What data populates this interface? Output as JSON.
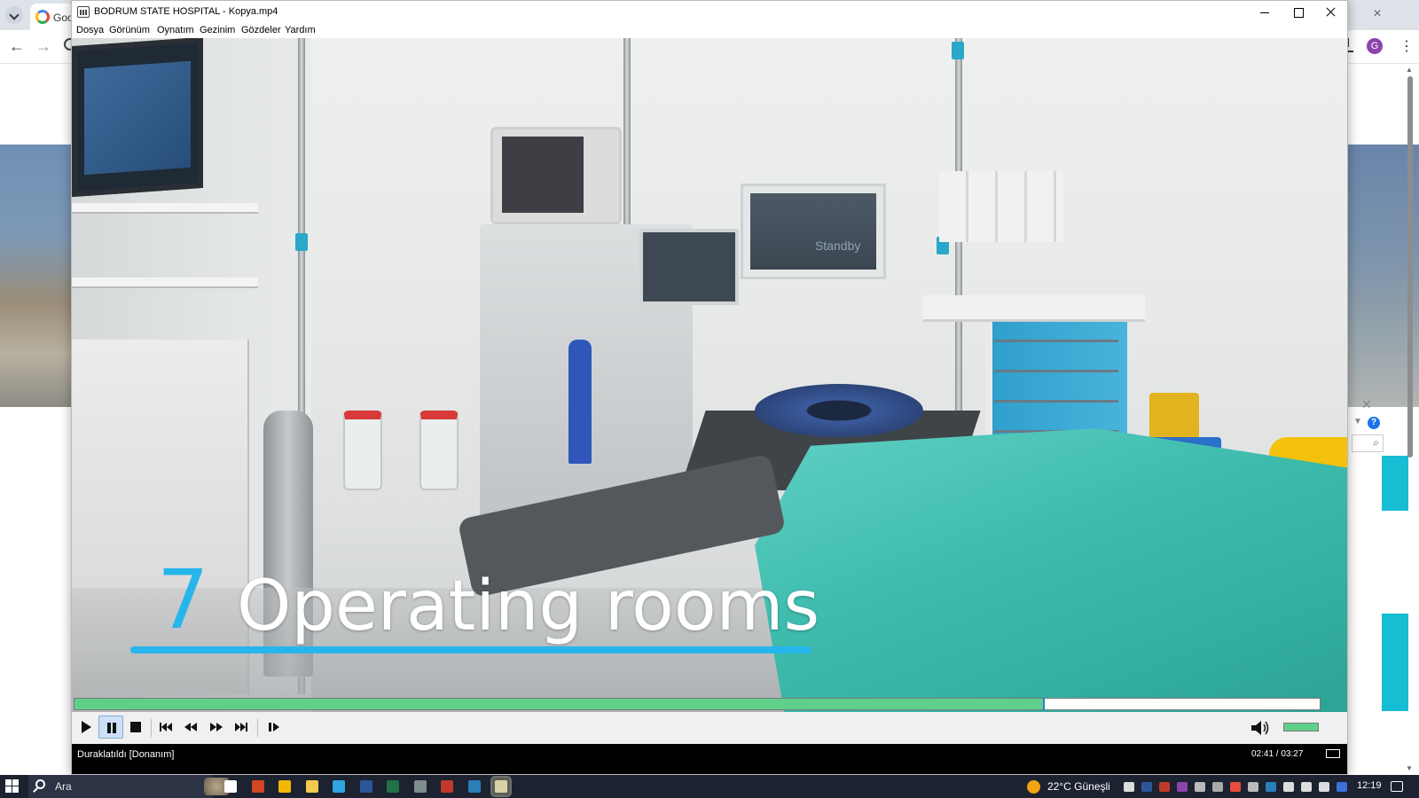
{
  "browser": {
    "tab_title": "Goo",
    "avatar_letter": "G"
  },
  "player": {
    "window_title": "BODRUM STATE HOSPITAL - Kopya.mp4",
    "menu": [
      "Dosya",
      "Görünüm",
      "Oynatım",
      "Gezinim",
      "Gözdeler",
      "Yardım"
    ],
    "video": {
      "caption_number": "7",
      "caption_text": "Operating rooms",
      "monitor_text": "Standby"
    },
    "seek_progress": 0.778,
    "volume_level": 1.0,
    "controls": [
      "play",
      "pause",
      "stop",
      "previous",
      "rewind",
      "fast-forward",
      "next",
      "frame-step"
    ],
    "paused": true,
    "status": "Duraklatıldı [Donanım]",
    "time": "02:41 / 03:27",
    "accent_color": "#27b6ec",
    "progress_color": "#5fd08a"
  },
  "taskbar": {
    "search_placeholder": "Ara",
    "apps": [
      {
        "icon": "task-view-icon",
        "color": "#ffffff"
      },
      {
        "icon": "powerpoint-icon",
        "color": "#d24726"
      },
      {
        "icon": "chrome-icon",
        "color": "#f2b705"
      },
      {
        "icon": "file-explorer-icon",
        "color": "#f3c94e"
      },
      {
        "icon": "telegram-icon",
        "color": "#2ca5e0"
      },
      {
        "icon": "word-icon",
        "color": "#2b579a"
      },
      {
        "icon": "excel-icon",
        "color": "#217346"
      },
      {
        "icon": "app-icon",
        "color": "#7f8c8d"
      },
      {
        "icon": "app-icon-2",
        "color": "#c0392b"
      },
      {
        "icon": "app-icon-3",
        "color": "#2980b9"
      },
      {
        "icon": "media-player-icon",
        "color": "#d9d2a6"
      }
    ],
    "weather": "22°C Güneşli",
    "clock": "12:19"
  }
}
